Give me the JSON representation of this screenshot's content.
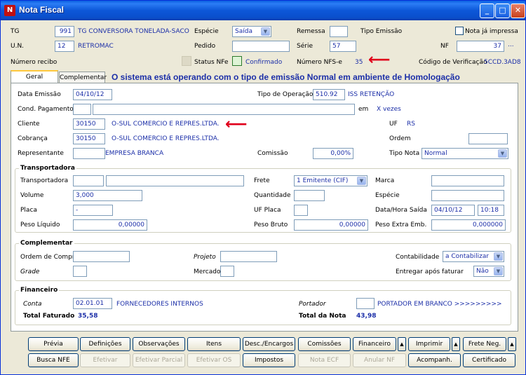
{
  "window": {
    "title": "Nota Fiscal"
  },
  "header": {
    "tg_label": "TG",
    "tg_code": "991",
    "tg_name": "TG CONVERSORA TONELADA-SACO",
    "un_label": "U.N.",
    "un_code": "12",
    "un_name": "RETROMAC",
    "especie_label": "Espécie",
    "especie_value": "Saída",
    "pedido_label": "Pedido",
    "remessa_label": "Remessa",
    "serie_label": "Série",
    "serie_value": "57",
    "tipo_emissao_label": "Tipo Emissão",
    "nota_impressa_label": "Nota já impressa",
    "nf_label": "NF",
    "nf_value": "37",
    "nf_more": "...",
    "numero_recibo_label": "Número recibo",
    "status_nfe_label": "Status NFe",
    "confirmado_label": "Confirmado",
    "numero_nfse_label": "Número NFS-e",
    "numero_nfse_value": "35",
    "codigo_verificacao_label": "Código de Verificação",
    "codigo_verificacao_value": "5CCD.3AD8"
  },
  "tabs": [
    "Geral",
    "Complementar"
  ],
  "message": "O sistema está operando com o tipo de emissão Normal em ambiente de Homologação",
  "geral": {
    "data_emissao_label": "Data Emissão",
    "data_emissao": "04/10/12",
    "tipo_operacao_label": "Tipo de Operação",
    "tipo_operacao_code": "510.92",
    "tipo_operacao_name": "ISS RETENÇÃO",
    "cond_pagamento_label": "Cond. Pagamento",
    "em_label": "em",
    "vezes_label": "X vezes",
    "cliente_label": "Cliente",
    "cliente_code": "30150",
    "cliente_name": "O-SUL COMERCIO E REPRES.LTDA.",
    "uf_label": "UF",
    "uf_value": "RS",
    "cobranca_label": "Cobrança",
    "cobranca_code": "30150",
    "cobranca_name": "O-SUL COMERCIO E REPRES.LTDA.",
    "ordem_label": "Ordem",
    "representante_label": "Representante",
    "representante_name": "EMPRESA BRANCA",
    "comissao_label": "Comissão",
    "comissao_value": "0,00%",
    "tipo_nota_label": "Tipo Nota",
    "tipo_nota_value": "Normal"
  },
  "transportadora": {
    "title": "Transportadora",
    "transportadora_label": "Transportadora",
    "frete_label": "Frete",
    "frete_value": "1 Emitente (CIF)",
    "marca_label": "Marca",
    "volume_label": "Volume",
    "volume_value": "3,000",
    "quantidade_label": "Quantidade",
    "especie_label": "Espécie",
    "placa_label": "Placa",
    "placa_value": "-",
    "uf_placa_label": "UF Placa",
    "data_hora_saida_label": "Data/Hora Saída",
    "data_saida": "04/10/12",
    "hora_saida": "10:18",
    "peso_liquido_label": "Peso Líquido",
    "peso_liquido": "0,00000",
    "peso_bruto_label": "Peso Bruto",
    "peso_bruto": "0,00000",
    "peso_extra_label": "Peso Extra Emb.",
    "peso_extra": "0,000000"
  },
  "complementar": {
    "title": "Complementar",
    "ordem_compra_label": "Ordem de Compra",
    "projeto_label": "Projeto",
    "contabilidade_label": "Contabilidade",
    "contabilidade_value": "a Contabilizar",
    "grade_label": "Grade",
    "mercado_label": "Mercado",
    "entregar_label": "Entregar após faturar",
    "entregar_value": "Não"
  },
  "financeiro": {
    "title": "Financeiro",
    "conta_label": "Conta",
    "conta_code": "02.01.01",
    "conta_name": "FORNECEDORES INTERNOS",
    "portador_label": "Portador",
    "portador_name": "PORTADOR EM BRANCO >>>>>>>>>",
    "total_faturado_label": "Total Faturado",
    "total_faturado": "35,58",
    "total_nota_label": "Total da Nota",
    "total_nota": "43,98"
  },
  "buttons": {
    "row1": [
      "Prévia",
      "Definições",
      "Observações",
      "Itens",
      "Desc./Encargos",
      "Comissões",
      "Financeiro",
      "Imprimir",
      "Frete Neg."
    ],
    "row2": [
      "Busca NFE",
      "Efetivar",
      "Efetivar Parcial",
      "Efetivar OS",
      "Impostos",
      "Nota ECF",
      "Anular NF",
      "Acompanh.",
      "Certificado"
    ]
  },
  "colors": {
    "accent": "#1c2fa8",
    "arrow": "#e0001b",
    "titlebar": "#0a5fe0"
  }
}
